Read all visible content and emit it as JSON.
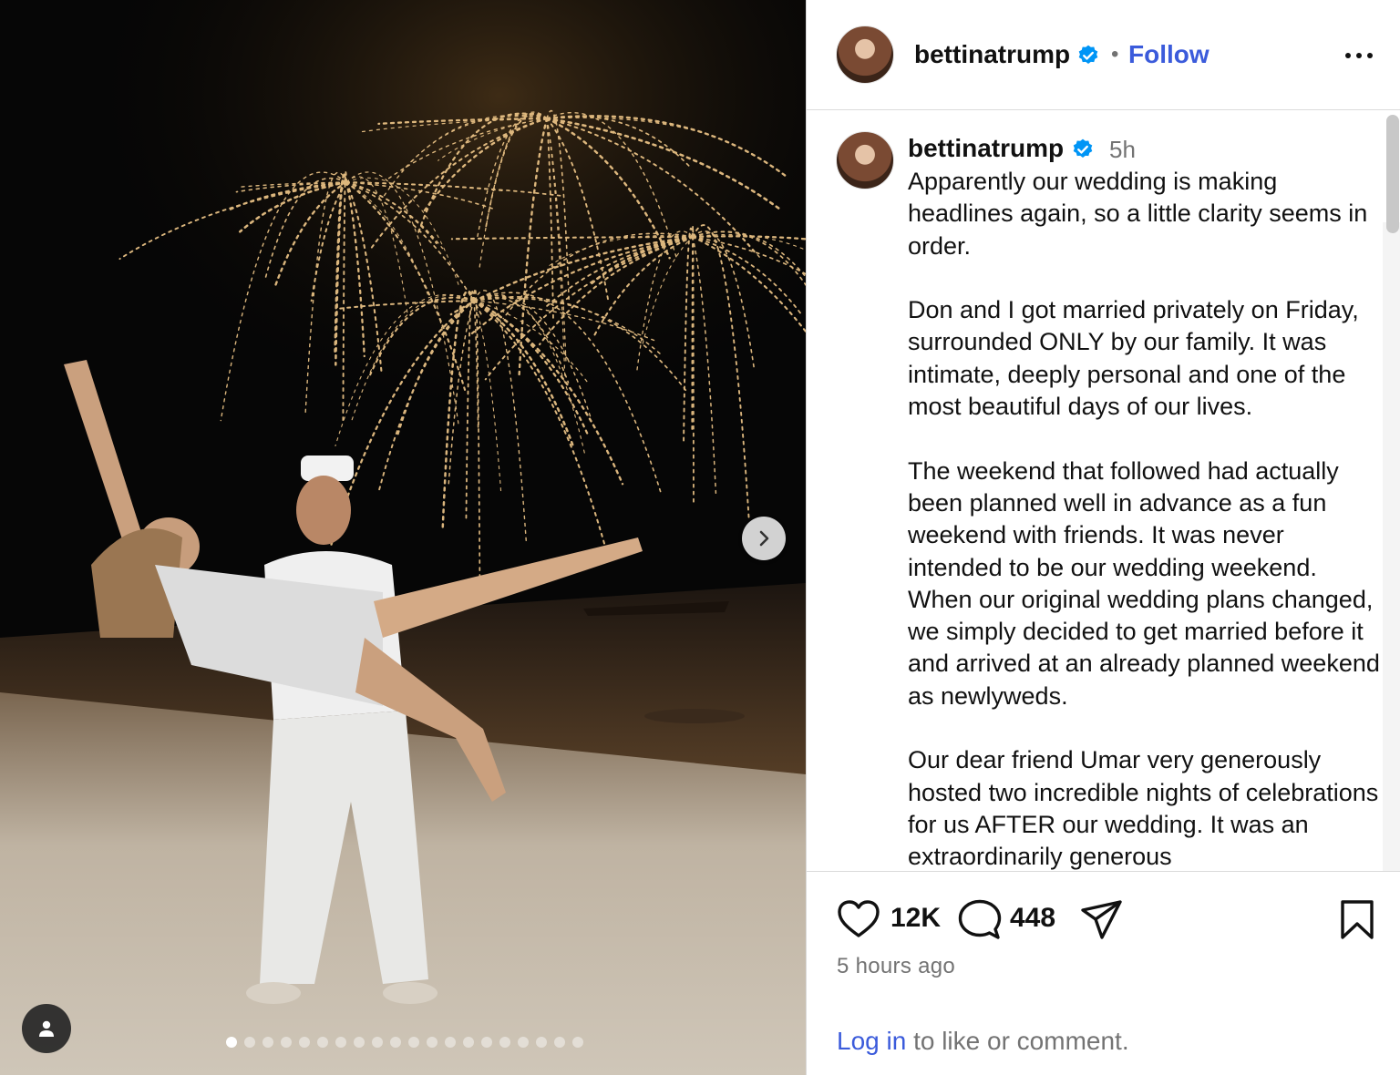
{
  "header": {
    "username": "bettinatrump",
    "separator": "•",
    "follow_label": "Follow"
  },
  "caption": {
    "username": "bettinatrump",
    "time": "5h",
    "text": "Apparently our wedding is making headlines again, so a little clarity seems in order.\n\nDon and I got married privately on Friday, surrounded ONLY by our family. It was intimate, deeply personal and one of the most beautiful days of our lives.\n\nThe weekend that followed had actually been planned well in advance as a fun weekend with friends. It was never intended to be our wedding weekend. When our original wedding plans changed, we simply decided to get married before it and arrived at an already planned weekend as newlyweds.\n\nOur dear friend Umar very generously hosted two incredible nights of celebrations for us AFTER our wedding. It was an extraordinarily generous"
  },
  "actions": {
    "like_count": "12K",
    "comment_count": "448",
    "time_ago": "5 hours ago",
    "login_link": "Log in",
    "login_suffix": " to like or comment."
  },
  "carousel": {
    "total_slides": 20,
    "current_slide": 1
  },
  "icons": {
    "verified": "verified-badge-icon",
    "more": "more-options-icon",
    "like": "heart-icon",
    "comment": "comment-icon",
    "share": "share-icon",
    "save": "bookmark-icon",
    "next": "chevron-right-icon",
    "tag": "user-tag-icon"
  },
  "colors": {
    "link": "#3b5bdb",
    "verified": "#0095f6",
    "muted": "#737373"
  }
}
